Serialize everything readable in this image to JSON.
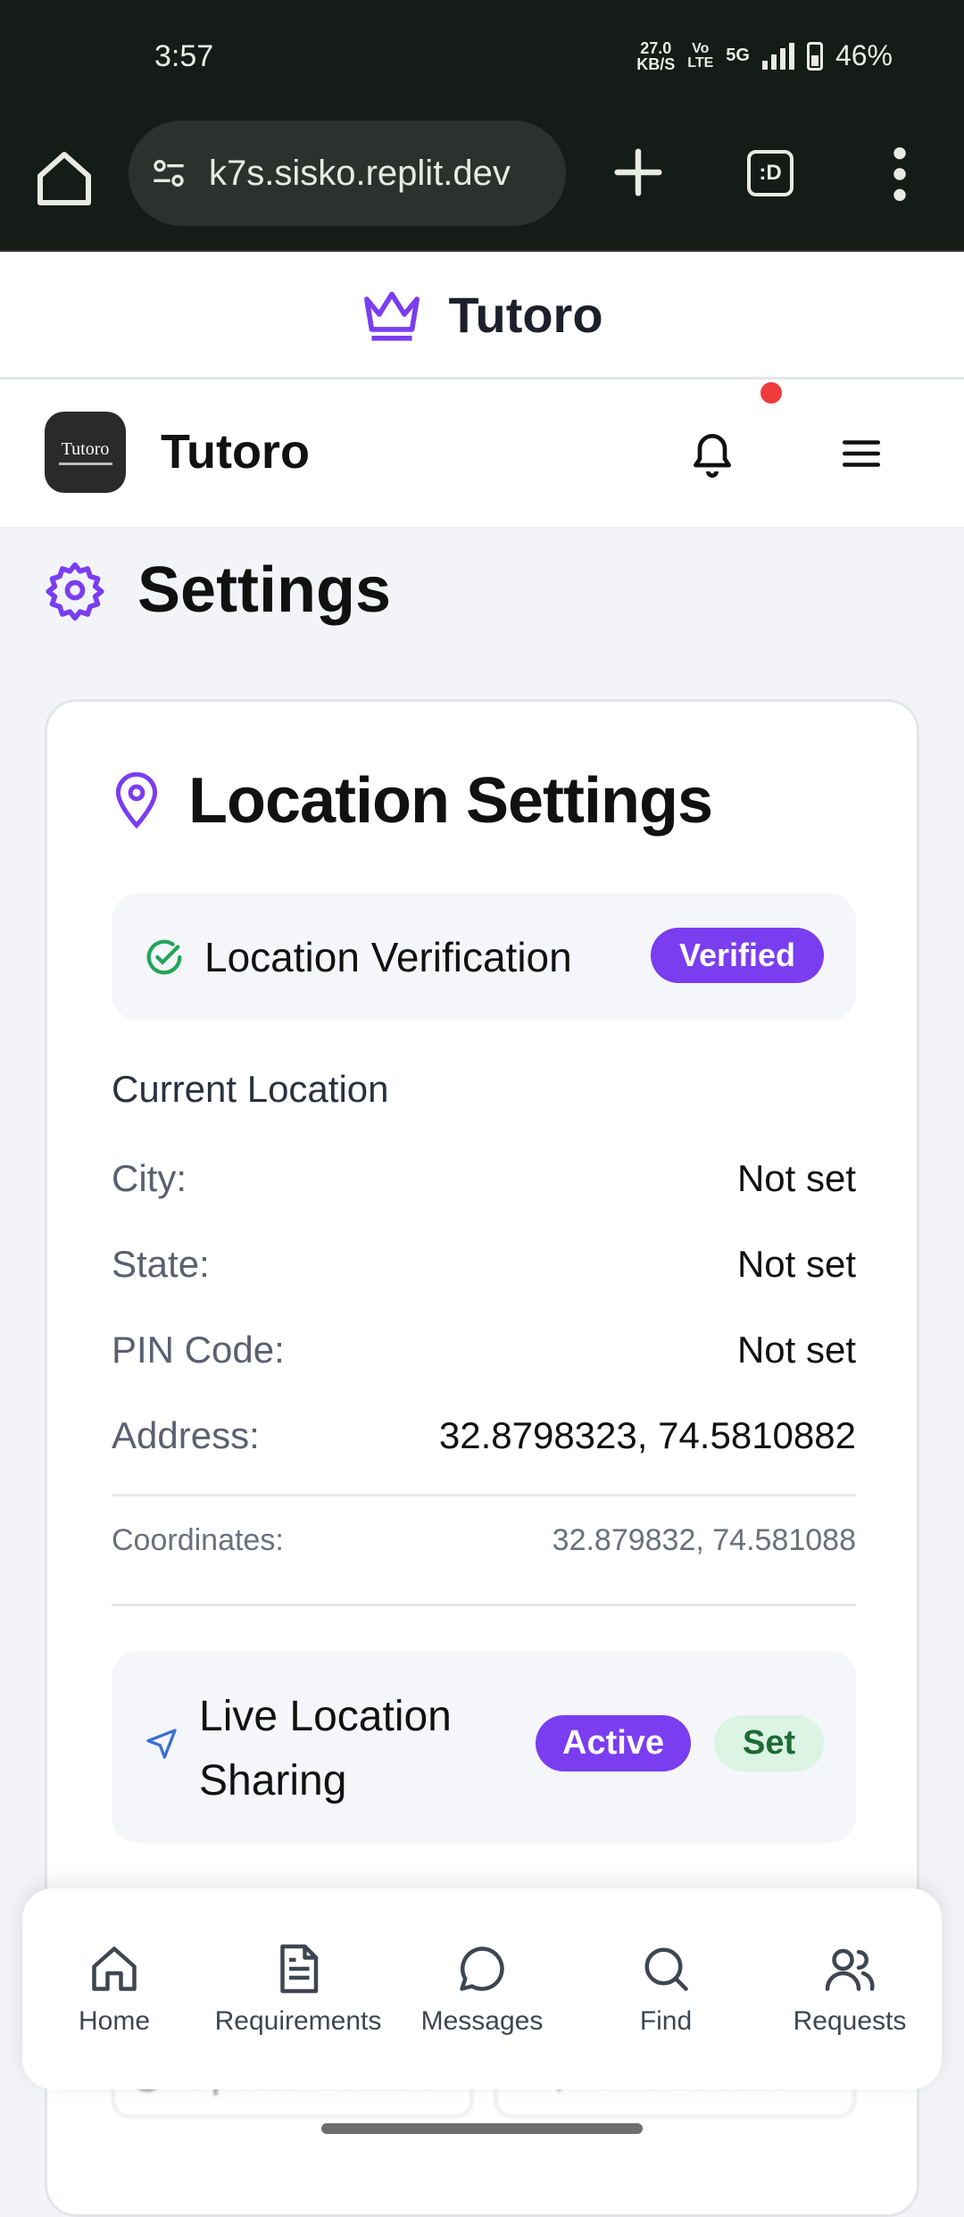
{
  "status_bar": {
    "time": "3:57",
    "net_speed_value": "27.0",
    "net_speed_unit": "KB/S",
    "volte_top": "Vo",
    "volte_bottom": "LTE",
    "network": "5G",
    "battery": "46%"
  },
  "browser": {
    "url": "k7s.sisko.replit.dev",
    "tabs_label": ":D"
  },
  "site_header": {
    "title": "Tutoro"
  },
  "app_header": {
    "logo_text": "Tutoro",
    "app_name": "Tutoro"
  },
  "page": {
    "title": "Settings"
  },
  "location_card": {
    "title": "Location Settings",
    "verification_label": "Location Verification",
    "verification_badge": "Verified",
    "section_label": "Current Location",
    "fields": [
      {
        "key": "City:",
        "value": "Not set"
      },
      {
        "key": "State:",
        "value": "Not set"
      },
      {
        "key": "PIN Code:",
        "value": "Not set"
      },
      {
        "key": "Address:",
        "value": "32.8798323, 74.5810882"
      }
    ],
    "coordinates_key": "Coordinates:",
    "coordinates_value": "32.879832, 74.581088",
    "live_label": "Live Location Sharing",
    "live_badge_active": "Active",
    "live_badge_set": "Set",
    "btn_update": "Update Location",
    "btn_live": "Live Location"
  },
  "bottom_nav": {
    "items": [
      {
        "label": "Home",
        "icon": "home-icon"
      },
      {
        "label": "Requirements",
        "icon": "document-icon"
      },
      {
        "label": "Messages",
        "icon": "chat-icon"
      },
      {
        "label": "Find",
        "icon": "search-icon"
      },
      {
        "label": "Requests",
        "icon": "users-icon"
      }
    ]
  },
  "colors": {
    "accent": "#7a3df0",
    "verified_check": "#22a55a",
    "set_badge_bg": "#dcf4e3",
    "notification_dot": "#ef3b3b"
  }
}
